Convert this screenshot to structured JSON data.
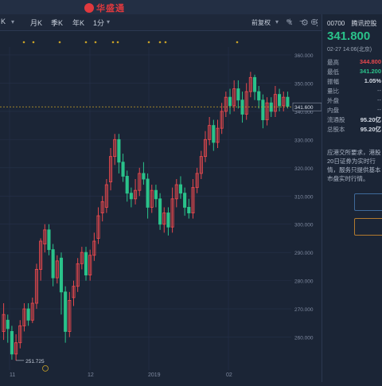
{
  "app": {
    "brand": "华盛通"
  },
  "toolbar": {
    "tabs": [
      {
        "label": "K"
      },
      {
        "label": "月K"
      },
      {
        "label": "季K"
      },
      {
        "label": "年K"
      },
      {
        "label": "1分"
      }
    ],
    "adjust_label": "前复权",
    "icons": [
      "pencil-icon",
      "settings-icon",
      "plus-icon",
      "minus-icon",
      "crosshair-icon"
    ]
  },
  "quote": {
    "code": "00700",
    "name": "腾讯控股",
    "price": "341.800",
    "timestamp": "02-27  14:06(北京)",
    "stats": [
      {
        "label": "最高",
        "value": "344.800",
        "color": "red"
      },
      {
        "label": "最低",
        "value": "341.200",
        "color": "green"
      },
      {
        "label": "振幅",
        "value": "1.05%",
        "color": "plain"
      },
      {
        "label": "量比",
        "value": "--",
        "color": "muted"
      },
      {
        "label": "外盘",
        "value": "--",
        "color": "muted"
      },
      {
        "label": "内盘",
        "value": "--",
        "color": "muted"
      },
      {
        "label": "流通股",
        "value": "95.20亿",
        "color": "plain"
      },
      {
        "label": "总股本",
        "value": "95.20亿",
        "color": "plain"
      }
    ],
    "notice": "应港交所要求，港股20日证券为实时行情，服务只提供基本市盘实时行情。"
  },
  "colors": {
    "up": "#e5484d",
    "down": "#2ac28a",
    "background": "#1b2536",
    "current_line": "#c9a227"
  },
  "chart_data": {
    "type": "candlestick",
    "y_axis": {
      "min": 250,
      "max": 360,
      "ticks": [
        "360.000",
        "350.000",
        "340.000",
        "330.000",
        "320.000",
        "310.000",
        "300.000",
        "290.000",
        "280.000",
        "270.000",
        "260.000"
      ]
    },
    "x_labels": [
      "11",
      "12",
      "2019",
      "02"
    ],
    "current_price_label": "341.600",
    "low_label": "251.725",
    "current_price": 341.6,
    "low": 251.725,
    "candles": [
      [
        262,
        268,
        272,
        259
      ],
      [
        266,
        263,
        268,
        258
      ],
      [
        262,
        254,
        264,
        252
      ],
      [
        254,
        258,
        261,
        251.7
      ],
      [
        258,
        264,
        266,
        256
      ],
      [
        264,
        270,
        272,
        262
      ],
      [
        270,
        266,
        272,
        264
      ],
      [
        266,
        272,
        274,
        265
      ],
      [
        272,
        284,
        286,
        270
      ],
      [
        284,
        294,
        295,
        280
      ],
      [
        293,
        298,
        300,
        290
      ],
      [
        298,
        291,
        300,
        289
      ],
      [
        291,
        281,
        293,
        278
      ],
      [
        281,
        287,
        289,
        279
      ],
      [
        288,
        276,
        290,
        268
      ],
      [
        276,
        262,
        278,
        258
      ],
      [
        262,
        273,
        276,
        260
      ],
      [
        274,
        278,
        280,
        271
      ],
      [
        278,
        286,
        288,
        276
      ],
      [
        286,
        290,
        292,
        284
      ],
      [
        290,
        282,
        292,
        280
      ],
      [
        282,
        289,
        291,
        280
      ],
      [
        289,
        294,
        297,
        287
      ],
      [
        295,
        303,
        306,
        293
      ],
      [
        304,
        308,
        310,
        301
      ],
      [
        306,
        314,
        316,
        304
      ],
      [
        315,
        324,
        327,
        312
      ],
      [
        324,
        330,
        332,
        321
      ],
      [
        330,
        322,
        332,
        318
      ],
      [
        322,
        317,
        325,
        315
      ],
      [
        317,
        311,
        319,
        308
      ],
      [
        311,
        309,
        313,
        306
      ],
      [
        309,
        312,
        316,
        307
      ],
      [
        312,
        318,
        320,
        310
      ],
      [
        318,
        316,
        322,
        314
      ],
      [
        316,
        306,
        318,
        302
      ],
      [
        306,
        312,
        314,
        304
      ],
      [
        312,
        309,
        314,
        306
      ],
      [
        309,
        300,
        311,
        298
      ],
      [
        300,
        304,
        306,
        297
      ],
      [
        304,
        299,
        306,
        296
      ],
      [
        299,
        309,
        313,
        297
      ],
      [
        309,
        314,
        316,
        306
      ],
      [
        314,
        311,
        317,
        309
      ],
      [
        311,
        306,
        313,
        303
      ],
      [
        306,
        304,
        309,
        302
      ],
      [
        304,
        313,
        316,
        302
      ],
      [
        313,
        318,
        320,
        311
      ],
      [
        318,
        324,
        326,
        316
      ],
      [
        324,
        330,
        333,
        322
      ],
      [
        330,
        335,
        338,
        328
      ],
      [
        335,
        329,
        337,
        326
      ],
      [
        329,
        334,
        337,
        327
      ],
      [
        334,
        340,
        343,
        332
      ],
      [
        340,
        345,
        347,
        338
      ],
      [
        345,
        342,
        348,
        339
      ],
      [
        342,
        348,
        351,
        340
      ],
      [
        348,
        344,
        351,
        341
      ],
      [
        344,
        339,
        347,
        336
      ],
      [
        339,
        347,
        350,
        337
      ],
      [
        347,
        352,
        354,
        345
      ],
      [
        352,
        347,
        353,
        344
      ],
      [
        347,
        344,
        349,
        341
      ],
      [
        344,
        337,
        346,
        334
      ],
      [
        337,
        343,
        345,
        335
      ],
      [
        343,
        340,
        345,
        338
      ],
      [
        340,
        346,
        349,
        338
      ],
      [
        346,
        342,
        348,
        340
      ],
      [
        342,
        345,
        347,
        340
      ],
      [
        345,
        341.8,
        347,
        341
      ]
    ]
  }
}
